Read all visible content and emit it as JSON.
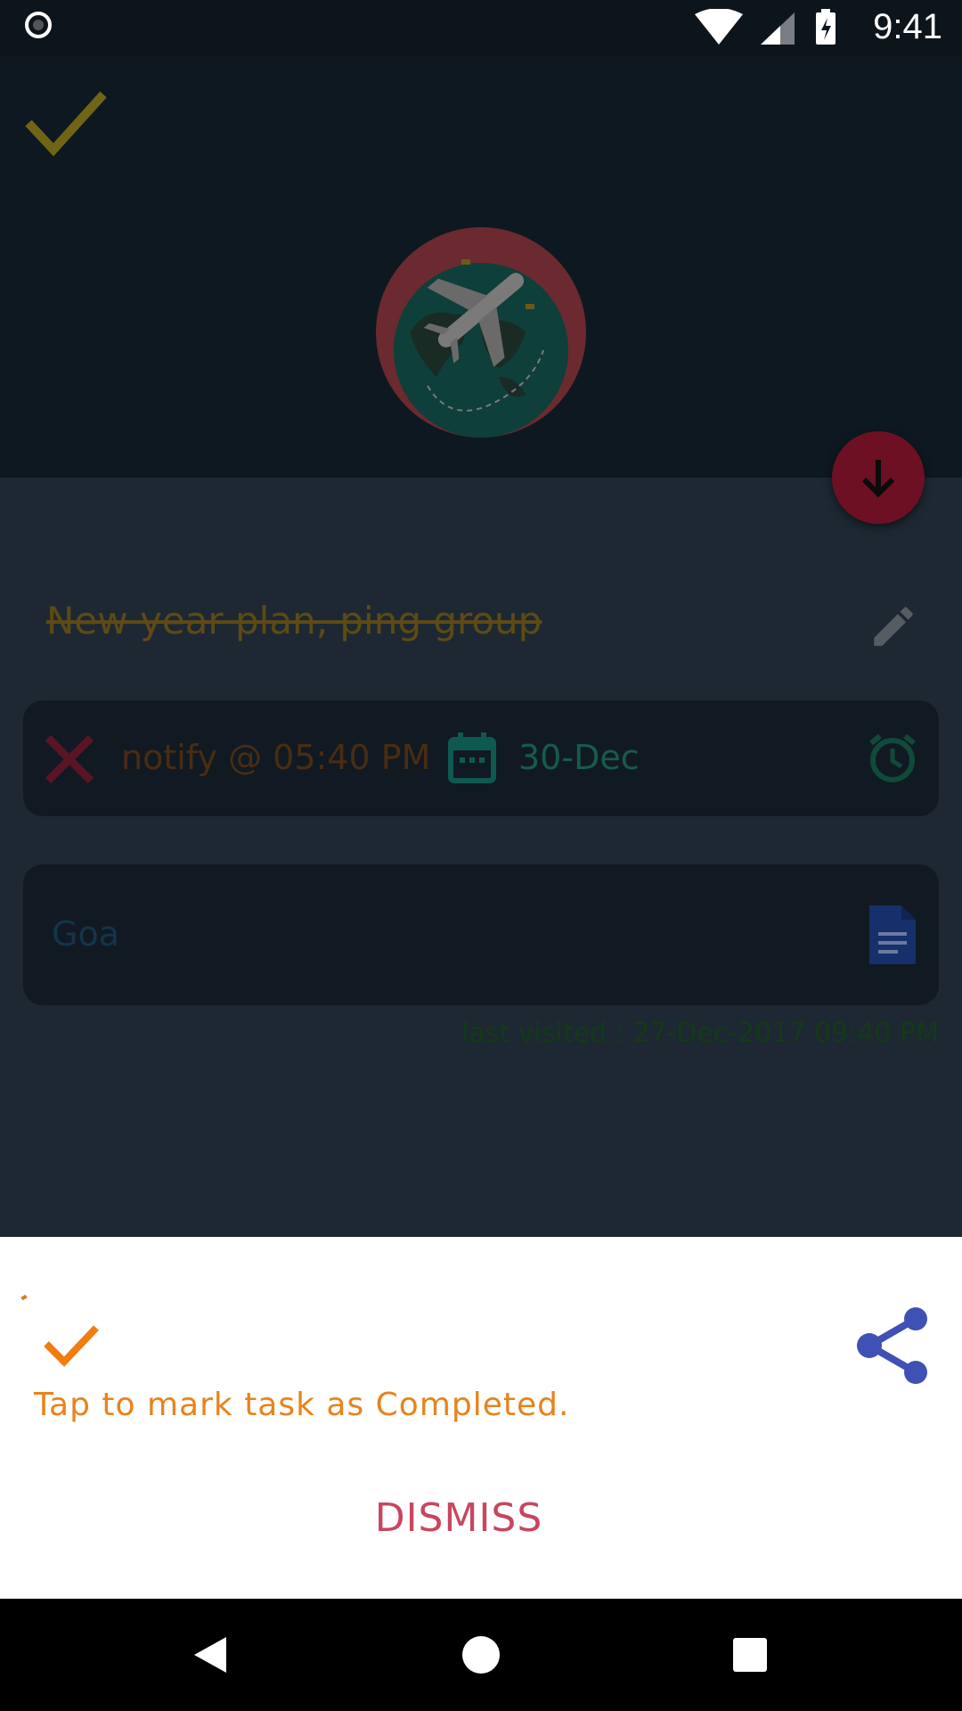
{
  "status_bar": {
    "time": "9:41"
  },
  "task": {
    "title": "New year plan, ping group",
    "notify_text": "notify @ 05:40 PM",
    "date": "30-Dec",
    "note": "Goa",
    "last_visited": "last visited : 27-Dec-2017 09:40 PM"
  },
  "bottom_sheet": {
    "message": "Tap to mark task as Completed.",
    "dismiss_label": "DISMISS"
  },
  "colors": {
    "accent_orange": "#e8831c",
    "dismiss_red": "#c8465e",
    "share_blue": "#3f51b5",
    "fab_red": "#6d1023"
  },
  "icons": [
    "record-icon",
    "wifi-icon",
    "signal-icon",
    "battery-icon",
    "check-icon",
    "travel-globe-icon",
    "arrow-down-icon",
    "edit-icon",
    "close-icon",
    "calendar-icon",
    "alarm-icon",
    "document-icon",
    "share-icon",
    "back-icon",
    "home-icon",
    "recents-icon"
  ]
}
